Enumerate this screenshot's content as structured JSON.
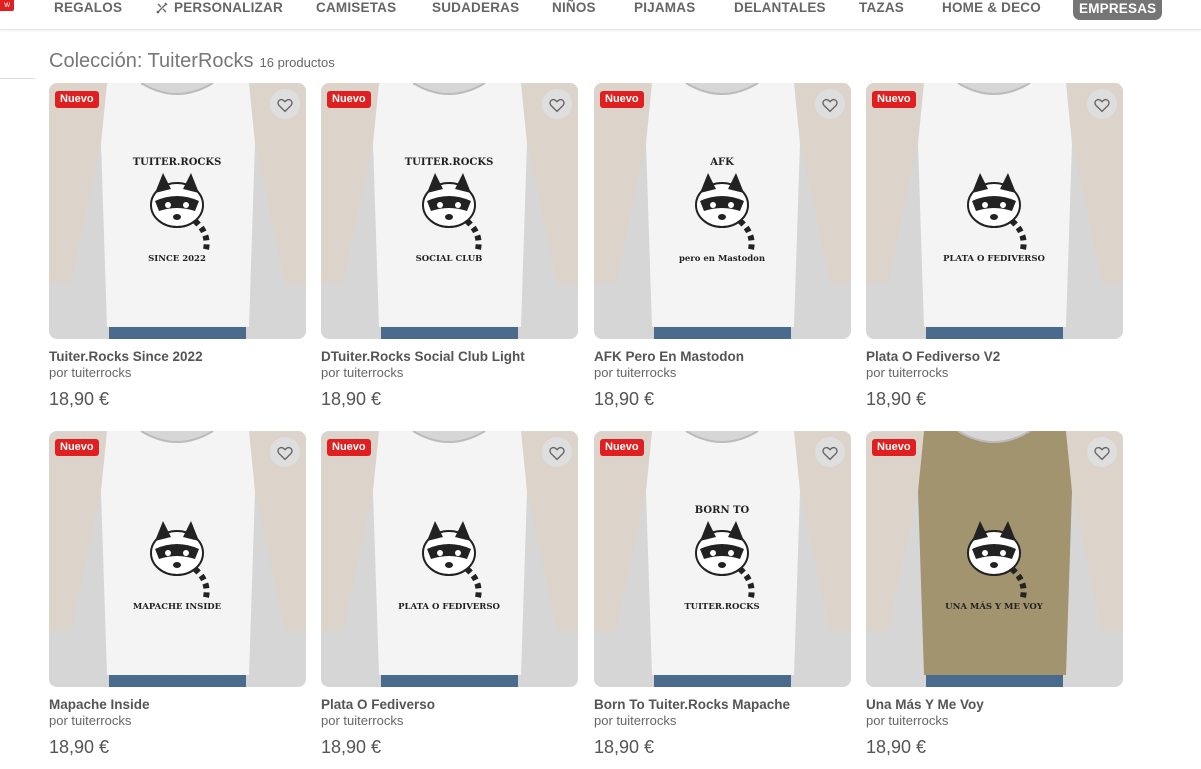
{
  "nav": {
    "badge": "w",
    "items": [
      "REGALOS",
      "PERSONALIZAR",
      "CAMISETAS",
      "SUDADERAS",
      "NIÑOS",
      "PIJAMAS",
      "DELANTALES",
      "TAZAS",
      "HOME & DECO",
      "EMPRESAS"
    ]
  },
  "collection": {
    "title": "Colección: TuiterRocks",
    "count": "16 productos"
  },
  "colors": {
    "badge": "#e02020",
    "shirt_white": "#f4f4f4",
    "shirt_khaki": "#a39470",
    "jeans": "#4a6b8d",
    "fav_bg": "#dedede"
  },
  "products": [
    {
      "badge": "Nuevo",
      "name": "Tuiter.Rocks Since 2022",
      "by": "por tuiterrocks",
      "price": "18,90 €",
      "shirt": "white",
      "print_top": "TUITER.ROCKS",
      "print_bottom": "SINCE 2022"
    },
    {
      "badge": "Nuevo",
      "name": "DTuiter.Rocks Social Club Light",
      "by": "por tuiterrocks",
      "price": "18,90 €",
      "shirt": "white",
      "print_top": "TUITER.ROCKS",
      "print_bottom": "SOCIAL CLUB"
    },
    {
      "badge": "Nuevo",
      "name": "AFK Pero En Mastodon",
      "by": "por tuiterrocks",
      "price": "18,90 €",
      "shirt": "white",
      "print_top": "AFK",
      "print_bottom": "pero en Mastodon"
    },
    {
      "badge": "Nuevo",
      "name": "Plata O Fediverso V2",
      "by": "por tuiterrocks",
      "price": "18,90 €",
      "shirt": "white",
      "print_top": "",
      "print_bottom": "PLATA O FEDIVERSO"
    },
    {
      "badge": "Nuevo",
      "name": "Mapache Inside",
      "by": "por tuiterrocks",
      "price": "18,90 €",
      "shirt": "white",
      "print_top": "",
      "print_bottom": "MAPACHE INSIDE"
    },
    {
      "badge": "Nuevo",
      "name": "Plata O Fediverso",
      "by": "por tuiterrocks",
      "price": "18,90 €",
      "shirt": "white",
      "print_top": "",
      "print_bottom": "PLATA O FEDIVERSO"
    },
    {
      "badge": "Nuevo",
      "name": "Born To Tuiter.Rocks Mapache",
      "by": "por tuiterrocks",
      "price": "18,90 €",
      "shirt": "white",
      "print_top": "BORN TO",
      "print_bottom": "TUITER.ROCKS"
    },
    {
      "badge": "Nuevo",
      "name": "Una Más Y Me Voy",
      "by": "por tuiterrocks",
      "price": "18,90 €",
      "shirt": "khaki",
      "print_top": "",
      "print_bottom": "UNA MÁS Y ME VOY"
    }
  ]
}
